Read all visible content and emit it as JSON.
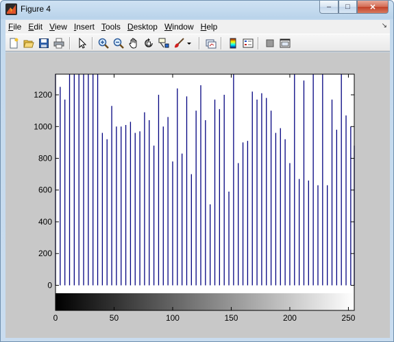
{
  "window": {
    "title": "Figure 4",
    "minimize_glyph": "–",
    "maximize_glyph": "□",
    "close_glyph": "✕"
  },
  "menu": {
    "items": [
      {
        "name": "file",
        "label": "File",
        "mnemonic": "F",
        "rest": "ile"
      },
      {
        "name": "edit",
        "label": "Edit",
        "mnemonic": "E",
        "rest": "dit"
      },
      {
        "name": "view",
        "label": "View",
        "mnemonic": "V",
        "rest": "iew"
      },
      {
        "name": "insert",
        "label": "Insert",
        "mnemonic": "I",
        "rest": "nsert"
      },
      {
        "name": "tools",
        "label": "Tools",
        "mnemonic": "T",
        "rest": "ools"
      },
      {
        "name": "desktop",
        "label": "Desktop",
        "mnemonic": "D",
        "rest": "esktop"
      },
      {
        "name": "window",
        "label": "Window",
        "mnemonic": "W",
        "rest": "indow"
      },
      {
        "name": "help",
        "label": "Help",
        "mnemonic": "H",
        "rest": "elp"
      }
    ],
    "dock_glyph": "↘"
  },
  "toolbar": {
    "buttons": [
      "new-figure-icon",
      "open-file-icon",
      "save-figure-icon",
      "print-figure-icon",
      "edit-plot-arrow-icon",
      "zoom-in-icon",
      "zoom-out-icon",
      "pan-hand-icon",
      "rotate-3d-icon",
      "data-cursor-icon",
      "brush-icon",
      "brush-dropdown-icon",
      "link-plot-icon",
      "insert-colorbar-icon",
      "insert-legend-icon",
      "hide-plot-tools-icon",
      "show-plot-tools-icon"
    ]
  },
  "chart_data": {
    "type": "bar",
    "subtype": "stem-histogram",
    "title": "",
    "xlabel": "",
    "ylabel": "",
    "xlim": [
      0,
      255
    ],
    "ylim": [
      -50,
      1330
    ],
    "xticks": [
      0,
      50,
      100,
      150,
      200,
      250
    ],
    "yticks": [
      0,
      200,
      400,
      600,
      800,
      1000,
      1200
    ],
    "colorbar": "grayscale 0-255 below x-axis",
    "bar_color": "#00007f",
    "x": [
      0,
      4,
      8,
      12,
      16,
      20,
      24,
      28,
      32,
      36,
      40,
      44,
      48,
      52,
      56,
      60,
      64,
      68,
      72,
      76,
      80,
      84,
      88,
      92,
      96,
      100,
      104,
      108,
      112,
      116,
      120,
      124,
      128,
      132,
      136,
      140,
      144,
      148,
      152,
      156,
      160,
      164,
      168,
      172,
      176,
      180,
      184,
      188,
      192,
      196,
      200,
      204,
      208,
      212,
      216,
      220,
      224,
      228,
      232,
      236,
      240,
      244,
      248,
      252,
      255
    ],
    "values": [
      1330,
      1250,
      1170,
      1330,
      1330,
      1330,
      1330,
      1330,
      1330,
      1330,
      960,
      920,
      1130,
      1000,
      1000,
      1010,
      1030,
      960,
      970,
      1090,
      1040,
      880,
      1200,
      1000,
      1060,
      780,
      1240,
      830,
      1190,
      700,
      1100,
      1260,
      1040,
      510,
      1170,
      1110,
      1200,
      590,
      1330,
      770,
      900,
      910,
      1220,
      1170,
      1210,
      1180,
      1100,
      960,
      990,
      920,
      770,
      1330,
      670,
      1290,
      660,
      1330,
      630,
      1330,
      630,
      1170,
      980,
      1330,
      1070,
      1000,
      880
    ]
  }
}
